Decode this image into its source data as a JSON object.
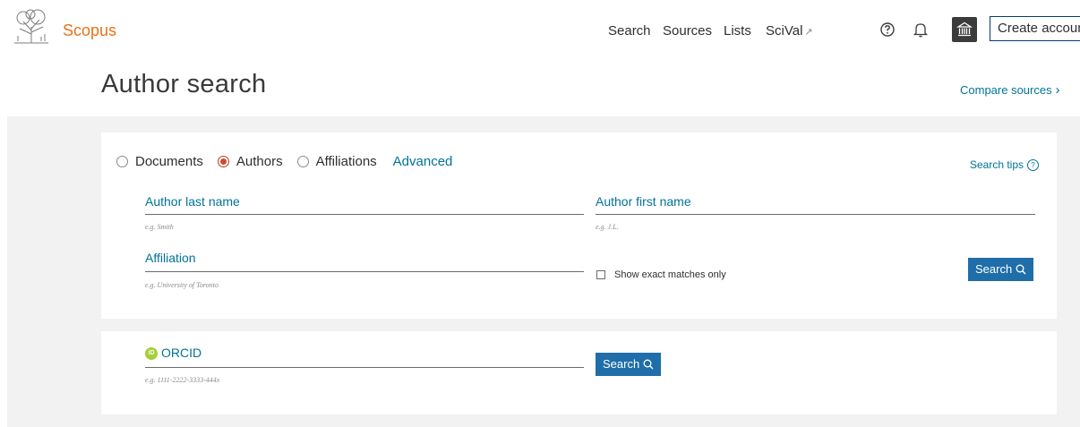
{
  "header": {
    "brand": "Scopus",
    "nav": [
      {
        "label": "Search"
      },
      {
        "label": "Sources"
      },
      {
        "label": "Lists"
      },
      {
        "label": "SciVal",
        "external_marker": "↗"
      }
    ],
    "create_account": "Create account"
  },
  "page": {
    "title": "Author search",
    "compare_sources": "Compare sources",
    "compare_chevron": "›"
  },
  "search_types": {
    "options": [
      "Documents",
      "Authors",
      "Affiliations"
    ],
    "selected": "Authors",
    "advanced": "Advanced",
    "search_tips": "Search tips"
  },
  "fields": {
    "last_name": {
      "label": "Author last name",
      "hint": "e.g. Smith",
      "value": ""
    },
    "first_name": {
      "label": "Author first name",
      "hint": "e.g. J.L.",
      "value": ""
    },
    "affiliation": {
      "label": "Affiliation",
      "hint": "e.g. University of Toronto",
      "value": ""
    },
    "exact_matches": "Show exact matches only",
    "search_button": "Search"
  },
  "orcid": {
    "icon_text": "iD",
    "label": "ORCID",
    "hint": "e.g. 1111-2222-3333-444x",
    "search_button": "Search"
  },
  "colors": {
    "brand_orange": "#e9711c",
    "link_blue": "#007398",
    "button_blue": "#1f6ea9",
    "radio_selected": "#d04a2c",
    "orcid_green": "#a6ce39"
  }
}
